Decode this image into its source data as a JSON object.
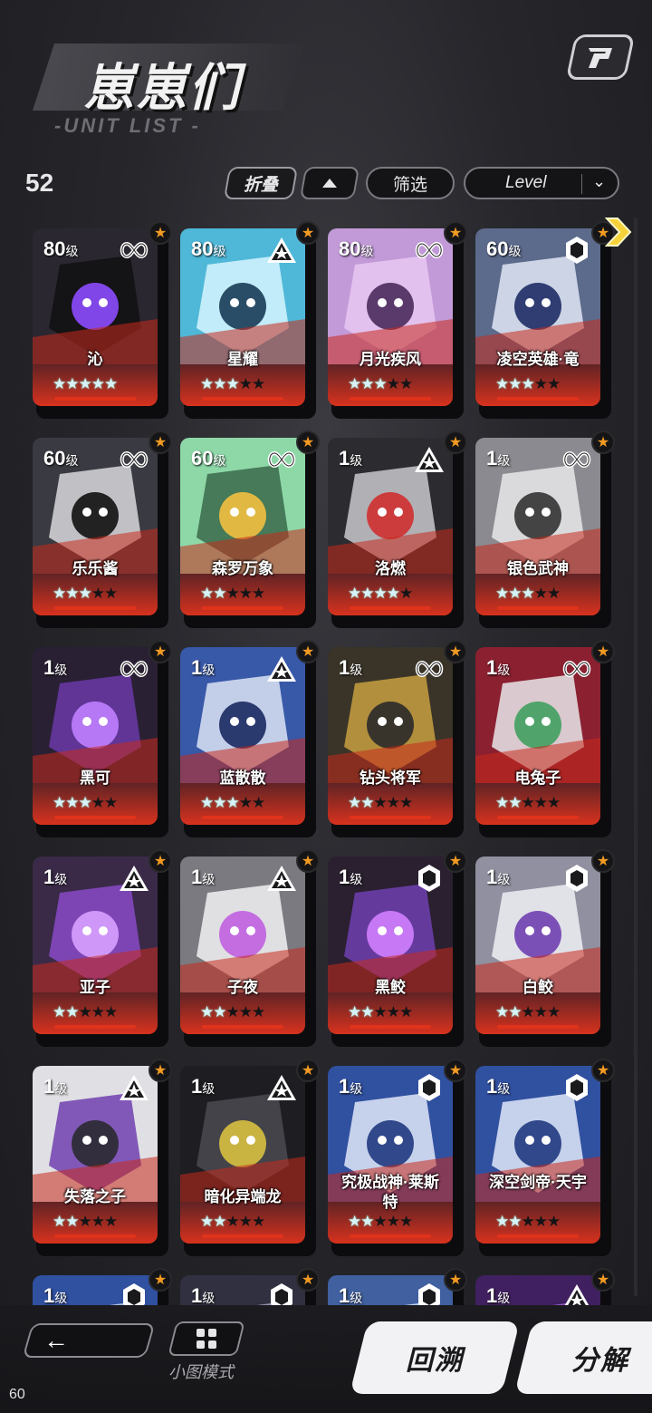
{
  "header": {
    "title": "崽崽们",
    "subtitle": "-UNIT LIST -"
  },
  "toolbar": {
    "count": "52",
    "fold_label": "折叠",
    "filter_label": "筛选",
    "sort_label": "Level"
  },
  "colors": {
    "accent": "#e0331c",
    "badge": "#f29a22",
    "star_on": "#d7f2f7",
    "button_light": "#f2f2f4"
  },
  "cards": [
    {
      "level": "80",
      "level_unit": "级",
      "name": "沁",
      "type_icon": "infinity-icon",
      "stars": 5
    },
    {
      "level": "80",
      "level_unit": "级",
      "name": "星耀",
      "type_icon": "triangle-star-icon",
      "stars": 3
    },
    {
      "level": "80",
      "level_unit": "级",
      "name": "月光疾风",
      "type_icon": "infinity-icon",
      "stars": 3
    },
    {
      "level": "60",
      "level_unit": "级",
      "name": "凌空英雄·竜",
      "type_icon": "hexagon-icon",
      "stars": 3
    },
    {
      "level": "60",
      "level_unit": "级",
      "name": "乐乐酱",
      "type_icon": "infinity-icon",
      "stars": 3
    },
    {
      "level": "60",
      "level_unit": "级",
      "name": "森罗万象",
      "type_icon": "infinity-icon",
      "stars": 2
    },
    {
      "level": "1",
      "level_unit": "级",
      "name": "洛燃",
      "type_icon": "triangle-star-icon",
      "stars": 4
    },
    {
      "level": "1",
      "level_unit": "级",
      "name": "银色武神",
      "type_icon": "infinity-icon",
      "stars": 3
    },
    {
      "level": "1",
      "level_unit": "级",
      "name": "黑可",
      "type_icon": "infinity-icon",
      "stars": 3
    },
    {
      "level": "1",
      "level_unit": "级",
      "name": "蓝散散",
      "type_icon": "triangle-star-icon",
      "stars": 3
    },
    {
      "level": "1",
      "level_unit": "级",
      "name": "钻头将军",
      "type_icon": "infinity-icon",
      "stars": 2
    },
    {
      "level": "1",
      "level_unit": "级",
      "name": "电兔子",
      "type_icon": "infinity-icon",
      "stars": 2
    },
    {
      "level": "1",
      "level_unit": "级",
      "name": "亚子",
      "type_icon": "triangle-star-icon",
      "stars": 2
    },
    {
      "level": "1",
      "level_unit": "级",
      "name": "子夜",
      "type_icon": "triangle-star-icon",
      "stars": 2
    },
    {
      "level": "1",
      "level_unit": "级",
      "name": "黑鲛",
      "type_icon": "hexagon-icon",
      "stars": 2
    },
    {
      "level": "1",
      "level_unit": "级",
      "name": "白鲛",
      "type_icon": "hexagon-icon",
      "stars": 2
    },
    {
      "level": "1",
      "level_unit": "级",
      "name": "失落之子",
      "type_icon": "triangle-star-icon",
      "stars": 2
    },
    {
      "level": "1",
      "level_unit": "级",
      "name": "暗化异端龙",
      "type_icon": "triangle-star-icon",
      "stars": 2
    },
    {
      "level": "1",
      "level_unit": "级",
      "name": "究极战神·莱斯特",
      "type_icon": "hexagon-icon",
      "stars": 2
    },
    {
      "level": "1",
      "level_unit": "级",
      "name": "深空剑帝·天宇",
      "type_icon": "hexagon-icon",
      "stars": 2
    },
    {
      "level": "1",
      "level_unit": "级",
      "name": "",
      "type_icon": "hexagon-icon",
      "stars": 0
    },
    {
      "level": "1",
      "level_unit": "级",
      "name": "",
      "type_icon": "hexagon-icon",
      "stars": 0
    },
    {
      "level": "1",
      "level_unit": "级",
      "name": "",
      "type_icon": "hexagon-icon",
      "stars": 0
    },
    {
      "level": "1",
      "level_unit": "级",
      "name": "",
      "type_icon": "triangle-star-icon",
      "stars": 0
    }
  ],
  "bottom": {
    "mini_mode_label": "小图模式",
    "rewind_label": "回溯",
    "decompose_label": "分解",
    "fps": "60"
  }
}
